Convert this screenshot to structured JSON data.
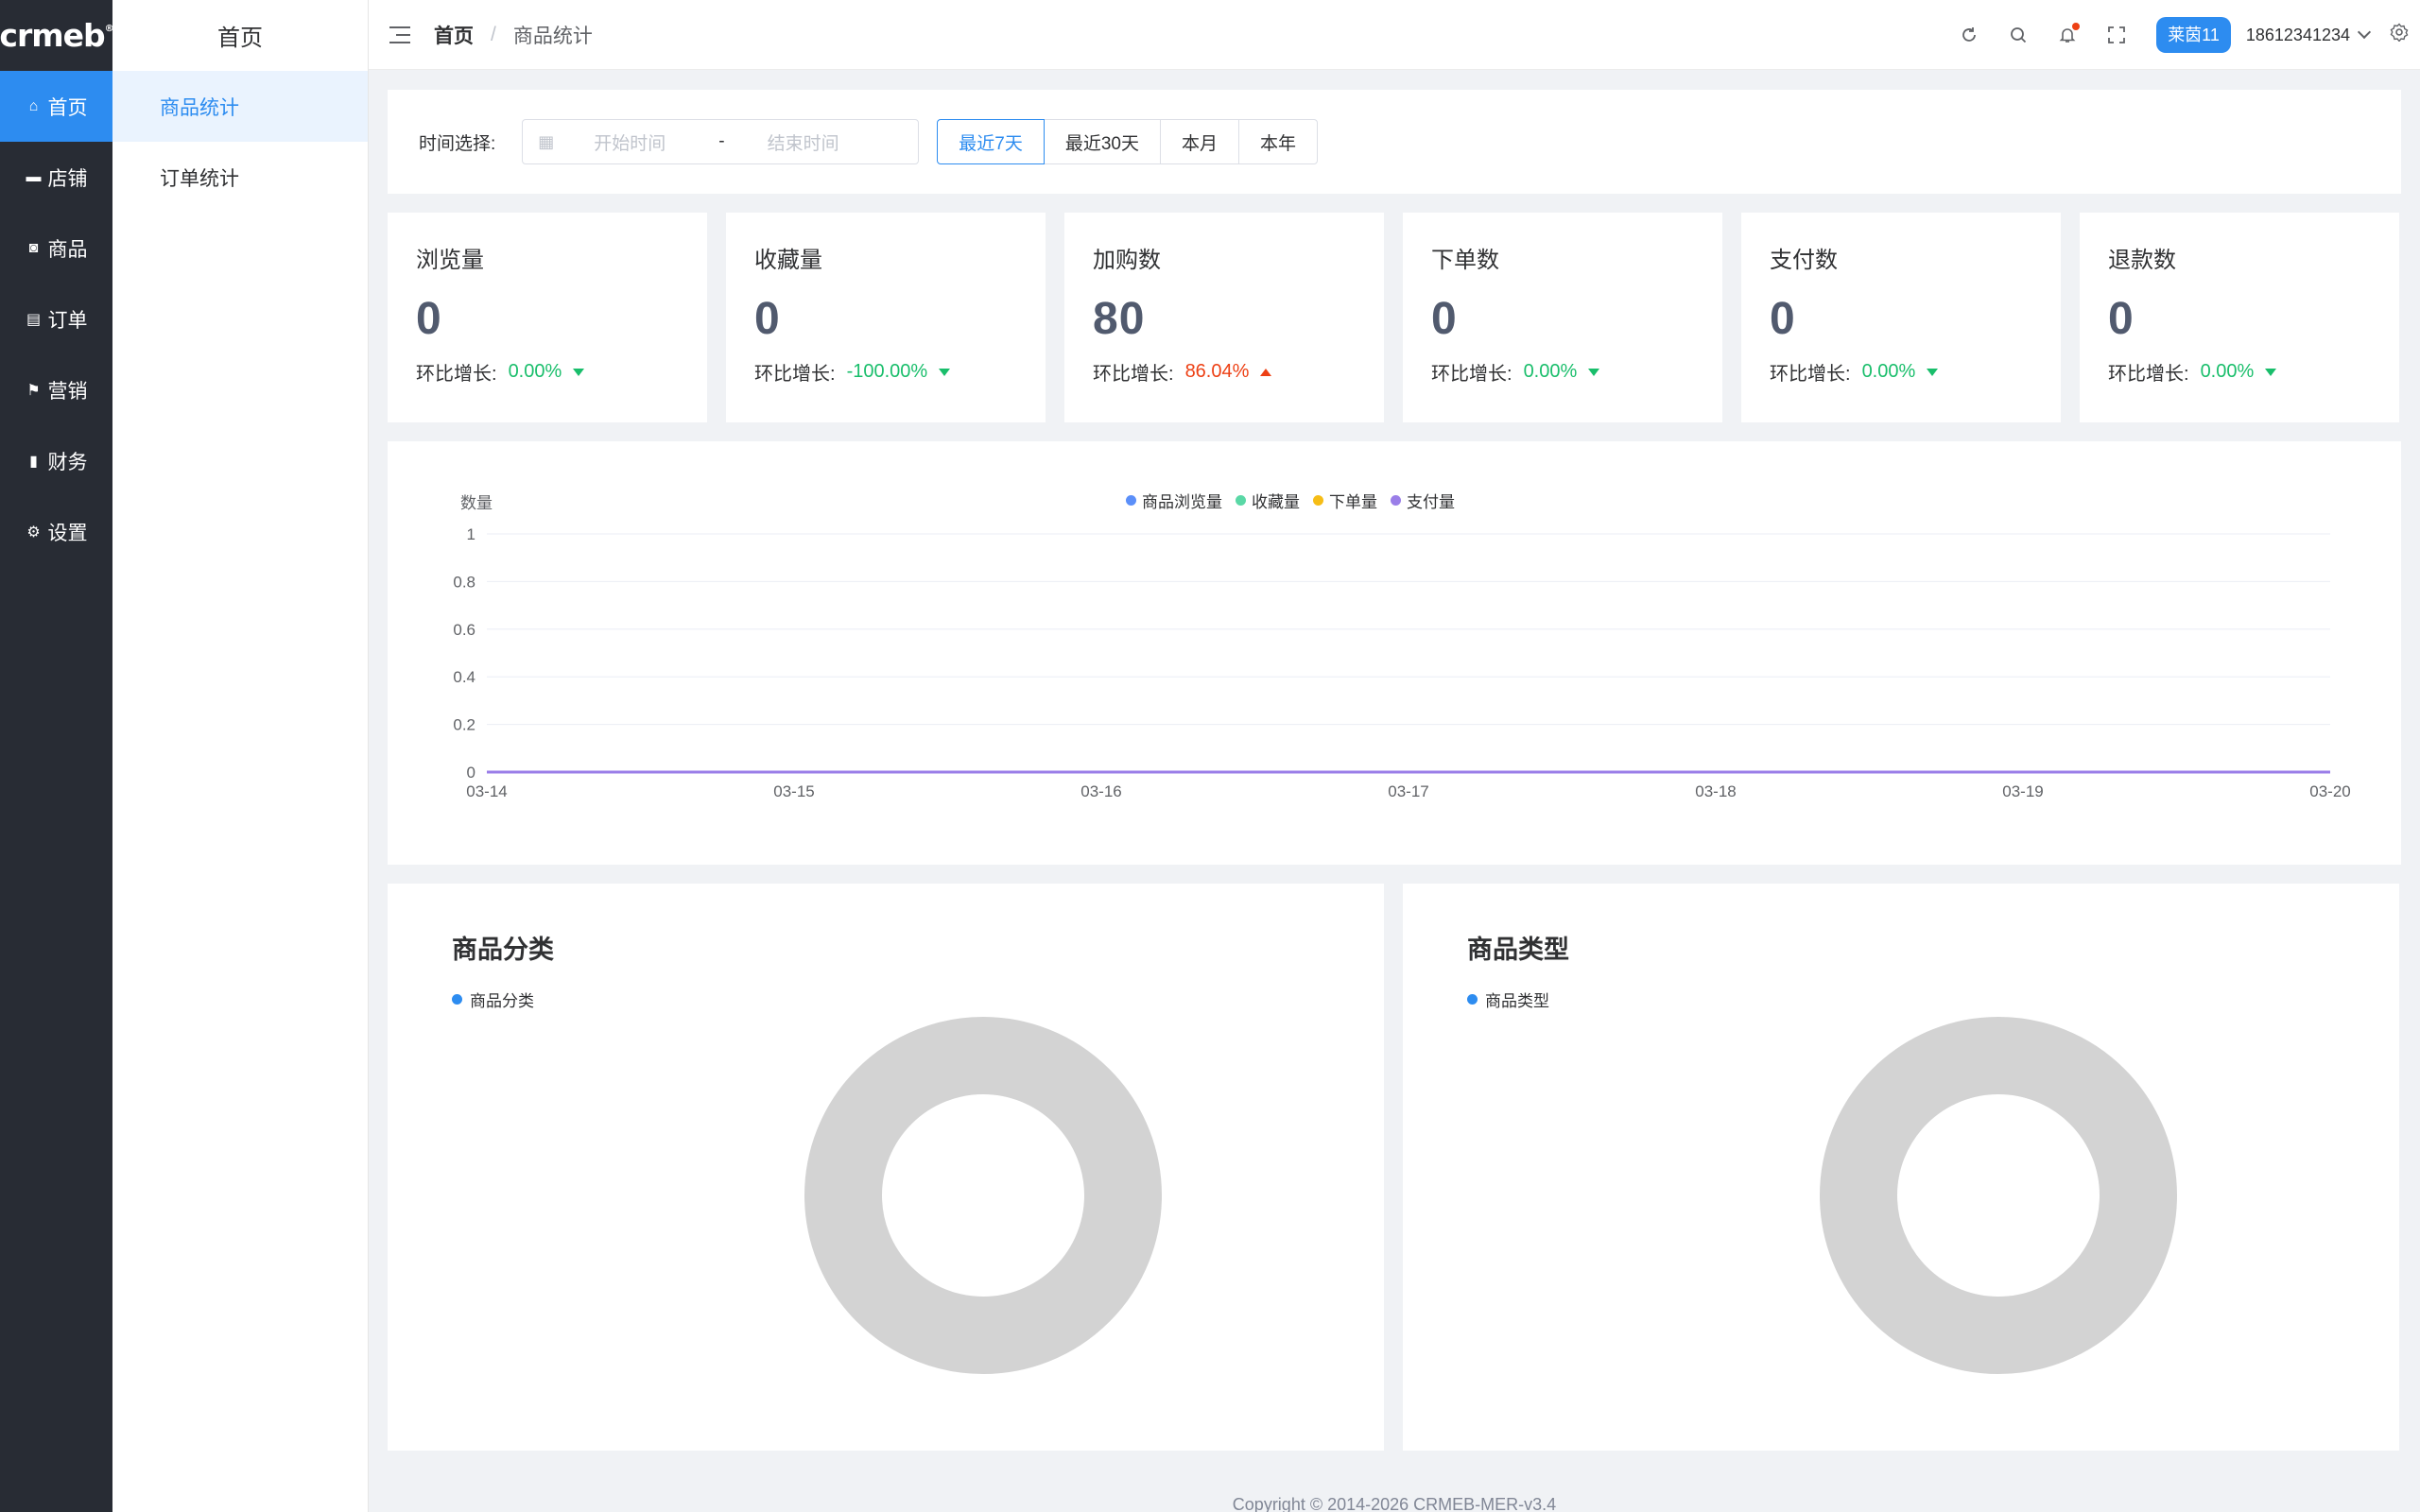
{
  "brand": {
    "logo_text": "crmeb",
    "logo_mark": "®"
  },
  "nav": [
    {
      "label": "首页",
      "icon": "home-icon",
      "glyph": "⌂",
      "active": true
    },
    {
      "label": "店铺",
      "icon": "store-icon",
      "glyph": "▬",
      "active": false
    },
    {
      "label": "商品",
      "icon": "bag-icon",
      "glyph": "◙",
      "active": false
    },
    {
      "label": "订单",
      "icon": "order-icon",
      "glyph": "▤",
      "active": false
    },
    {
      "label": "营销",
      "icon": "flag-icon",
      "glyph": "⚑",
      "active": false
    },
    {
      "label": "财务",
      "icon": "bar-chart-icon",
      "glyph": "▮",
      "active": false
    },
    {
      "label": "设置",
      "icon": "gear-icon",
      "glyph": "⚙",
      "active": false
    }
  ],
  "submenu": {
    "title": "首页",
    "items": [
      {
        "label": "商品统计",
        "active": true
      },
      {
        "label": "订单统计",
        "active": false
      }
    ]
  },
  "header": {
    "breadcrumb": [
      "首页",
      "商品统计"
    ],
    "separator": "/",
    "user_badge": "莱茵11",
    "user_phone": "18612341234"
  },
  "filter": {
    "label": "时间选择:",
    "start_placeholder": "开始时间",
    "end_placeholder": "结束时间",
    "range_separator": "-",
    "quick_ranges": [
      "最近7天",
      "最近30天",
      "本月",
      "本年"
    ],
    "active_range": "最近7天"
  },
  "stats": [
    {
      "name": "浏览量",
      "value": "0",
      "trend_label": "环比增长:",
      "trend": "0.00%",
      "direction": "down"
    },
    {
      "name": "收藏量",
      "value": "0",
      "trend_label": "环比增长:",
      "trend": "-100.00%",
      "direction": "down"
    },
    {
      "name": "加购数",
      "value": "80",
      "trend_label": "环比增长:",
      "trend": "86.04%",
      "direction": "up"
    },
    {
      "name": "下单数",
      "value": "0",
      "trend_label": "环比增长:",
      "trend": "0.00%",
      "direction": "down"
    },
    {
      "name": "支付数",
      "value": "0",
      "trend_label": "环比增长:",
      "trend": "0.00%",
      "direction": "down"
    },
    {
      "name": "退款数",
      "value": "0",
      "trend_label": "环比增长:",
      "trend": "0.00%",
      "direction": "down"
    }
  ],
  "chart_data": [
    {
      "type": "line",
      "ylabel": "数量",
      "x": [
        "03-14",
        "03-15",
        "03-16",
        "03-17",
        "03-18",
        "03-19",
        "03-20"
      ],
      "ylim": [
        0,
        1
      ],
      "yticks": [
        "0",
        "0.2",
        "0.4",
        "0.6",
        "0.8",
        "1"
      ],
      "legend_position": "top-center",
      "grid": true,
      "series": [
        {
          "name": "商品浏览量",
          "color": "#5b8ff9",
          "values": [
            0,
            0,
            0,
            0,
            0,
            0,
            0
          ]
        },
        {
          "name": "收藏量",
          "color": "#5ad8a6",
          "values": [
            0,
            0,
            0,
            0,
            0,
            0,
            0
          ]
        },
        {
          "name": "下单量",
          "color": "#f6bd16",
          "values": [
            0,
            0,
            0,
            0,
            0,
            0,
            0
          ]
        },
        {
          "name": "支付量",
          "color": "#9a7ee8",
          "values": [
            0,
            0,
            0,
            0,
            0,
            0,
            0
          ]
        }
      ]
    },
    {
      "type": "pie",
      "title": "商品分类",
      "legend": [
        "商品分类"
      ],
      "series": [
        {
          "name": "商品分类",
          "values": []
        }
      ],
      "empty_color": "#d3d3d3"
    },
    {
      "type": "pie",
      "title": "商品类型",
      "legend": [
        "商品类型"
      ],
      "series": [
        {
          "name": "商品类型",
          "values": []
        }
      ],
      "empty_color": "#d3d3d3"
    }
  ],
  "footer": {
    "copyright": "Copyright © 2014-2026 CRMEB-MER-v3.4"
  }
}
